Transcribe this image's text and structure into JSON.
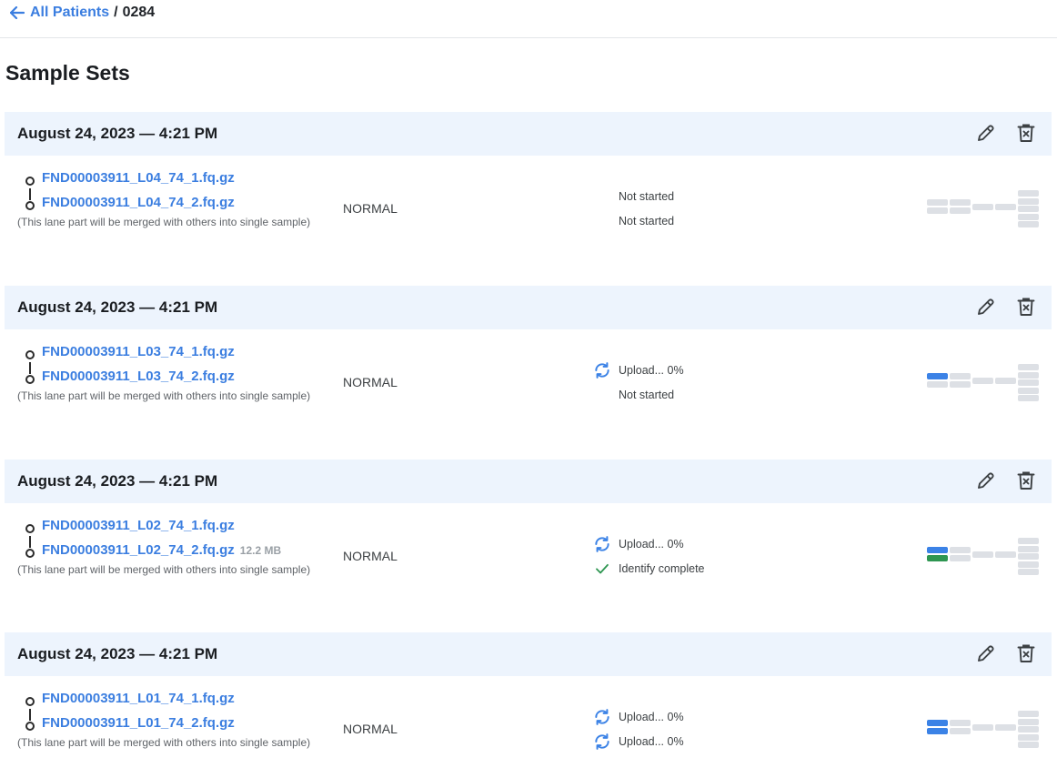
{
  "breadcrumb": {
    "back_label": "All Patients",
    "separator": "/",
    "current": "0284"
  },
  "page_title": "Sample Sets",
  "colors": {
    "link": "#3b7ee0",
    "header_bg": "#edf4fd",
    "progress_upload": "#3b82e6",
    "progress_identify": "#2e9651",
    "progress_empty": "#dde0e5",
    "check": "#2e9651"
  },
  "sample_sets": [
    {
      "date": "August 24, 2023 — 4:21 PM",
      "files": [
        {
          "name": "FND00003911_L04_74_1.fq.gz",
          "size": ""
        },
        {
          "name": "FND00003911_L04_74_2.fq.gz",
          "size": ""
        }
      ],
      "note": "(This lane part will be merged with others into single sample)",
      "type": "NORMAL",
      "statuses": [
        {
          "icon": "none",
          "text": "Not started"
        },
        {
          "icon": "none",
          "text": "Not started"
        }
      ],
      "progress": {
        "row1": "empty",
        "row2": "empty"
      }
    },
    {
      "date": "August 24, 2023 — 4:21 PM",
      "files": [
        {
          "name": "FND00003911_L03_74_1.fq.gz",
          "size": ""
        },
        {
          "name": "FND00003911_L03_74_2.fq.gz",
          "size": ""
        }
      ],
      "note": "(This lane part will be merged with others into single sample)",
      "type": "NORMAL",
      "statuses": [
        {
          "icon": "sync-icon",
          "text": "Upload... 0%"
        },
        {
          "icon": "none",
          "text": "Not started"
        }
      ],
      "progress": {
        "row1": "upload",
        "row2": "empty"
      }
    },
    {
      "date": "August 24, 2023 — 4:21 PM",
      "files": [
        {
          "name": "FND00003911_L02_74_1.fq.gz",
          "size": ""
        },
        {
          "name": "FND00003911_L02_74_2.fq.gz",
          "size": "12.2 MB"
        }
      ],
      "note": "(This lane part will be merged with others into single sample)",
      "type": "NORMAL",
      "statuses": [
        {
          "icon": "sync-icon",
          "text": "Upload... 0%"
        },
        {
          "icon": "check-icon",
          "text": "Identify complete"
        }
      ],
      "progress": {
        "row1": "upload",
        "row2": "identify"
      }
    },
    {
      "date": "August 24, 2023 — 4:21 PM",
      "files": [
        {
          "name": "FND00003911_L01_74_1.fq.gz",
          "size": ""
        },
        {
          "name": "FND00003911_L01_74_2.fq.gz",
          "size": ""
        }
      ],
      "note": "(This lane part will be merged with others into single sample)",
      "type": "NORMAL",
      "statuses": [
        {
          "icon": "sync-icon",
          "text": "Upload... 0%"
        },
        {
          "icon": "sync-icon",
          "text": "Upload... 0%"
        }
      ],
      "progress": {
        "row1": "upload",
        "row2": "upload"
      }
    }
  ]
}
